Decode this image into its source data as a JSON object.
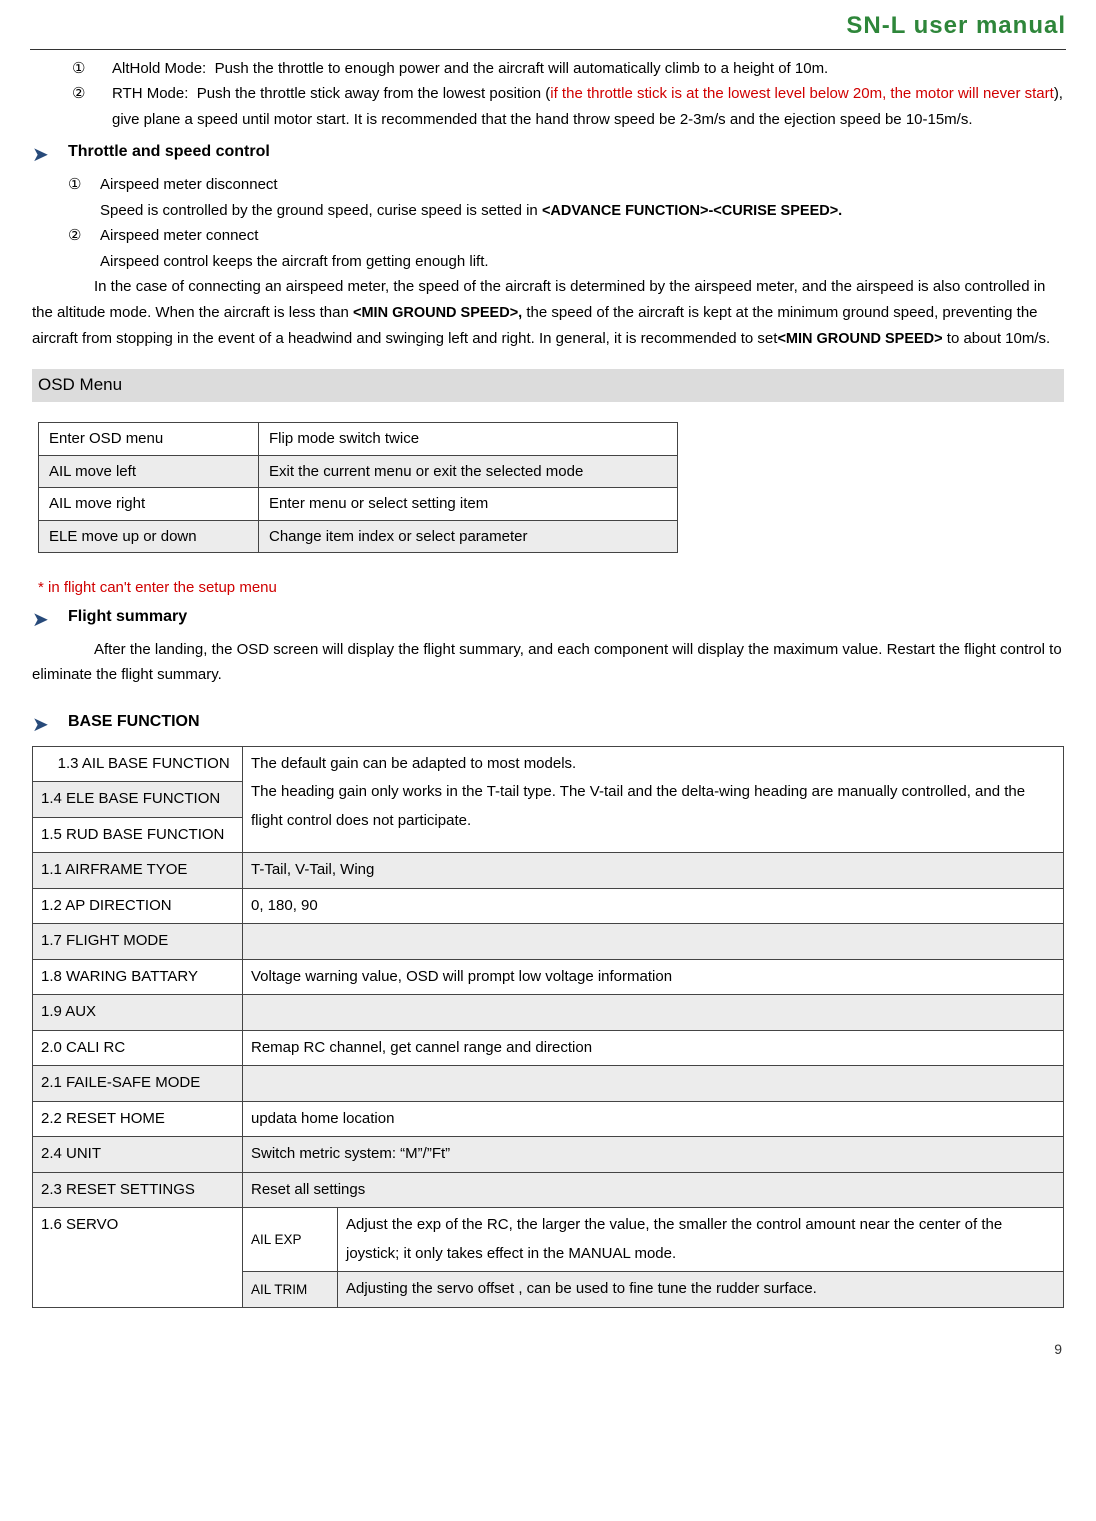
{
  "header": {
    "title": "SN-L user manual"
  },
  "intro": {
    "item1_num": "①",
    "item1_label": "AltHold Mode:",
    "item1_text": "Push the throttle to enough power and the aircraft will automatically climb to a height of 10m.",
    "item2_num": "②",
    "item2_label": "RTH Mode:",
    "item2_pre": "Push the throttle stick away from the lowest position (",
    "item2_red": "if the throttle stick is at the lowest level below 20m, the motor will never start",
    "item2_post": "), give plane a speed until motor start. It is recommended that the hand throw speed be 2-3m/s and the ejection speed be 10-15m/s."
  },
  "throttle": {
    "heading": "Throttle and speed control",
    "i1_num": "①",
    "i1_title": "Airspeed meter disconnect",
    "i1_text_a": "Speed is controlled by the ground speed, curise speed is setted in ",
    "i1_text_b": "<ADVANCE FUNCTION>-<CURISE SPEED>.",
    "i2_num": "②",
    "i2_title": "Airspeed meter connect",
    "i2_l1": "Airspeed control keeps the aircraft from getting enough lift.",
    "i2_l2a": "In the case of connecting an airspeed meter, the speed of the aircraft is determined by the airspeed meter, and the airspeed is also controlled in the altitude mode. When the aircraft is less than ",
    "i2_l2b": "<MIN GROUND SPEED>,",
    "i2_l2c": " the speed of the aircraft is kept at the minimum ground speed, preventing the aircraft from stopping in the event of a headwind and swinging left and right. In general, it is recommended to set",
    "i2_l2d": "<MIN GROUND SPEED>",
    "i2_l2e": " to about 10m/s."
  },
  "osd": {
    "heading": "OSD Menu",
    "rows": [
      {
        "c1": "Enter OSD menu",
        "c2": "Flip mode switch twice",
        "shaded": false
      },
      {
        "c1": "AIL move left",
        "c2": "Exit the current menu or exit the selected mode",
        "shaded": true
      },
      {
        "c1": "AIL move right",
        "c2": "Enter menu or select setting item",
        "shaded": false
      },
      {
        "c1": "ELE move up or down",
        "c2": "Change item index or select parameter",
        "shaded": true
      }
    ],
    "note": "* in flight can't enter the setup menu"
  },
  "flight_summary": {
    "heading": "Flight summary",
    "text": "After the landing, the OSD screen will display the flight summary, and each component will display the maximum value. Restart the flight control to eliminate the flight summary."
  },
  "base": {
    "heading": "BASE FUNCTION",
    "r1c1": "1.3 AIL BASE FUNCTION",
    "merged_desc": "The default gain can be adapted to most models.\nThe heading gain only works in the T-tail type. The V-tail and the delta-wing heading are manually controlled, and the flight control does not participate.",
    "r2c1": "1.4 ELE BASE FUNCTION",
    "r3c1": "1.5 RUD BASE FUNCTION",
    "r4c1": "1.1 AIRFRAME TYOE",
    "r4c2": "T-Tail,   V-Tail,   Wing",
    "r5c1": "1.2 AP DIRECTION",
    "r5c2": "0, 180, 90",
    "r6c1": "1.7 FLIGHT MODE",
    "r6c2": "",
    "r7c1": "1.8 WARING BATTARY",
    "r7c2": "Voltage warning value, OSD will prompt low voltage information",
    "r8c1": "1.9 AUX",
    "r8c2": "",
    "r9c1": "2.0 CALI RC",
    "r9c2": "Remap RC channel, get cannel range and direction",
    "r10c1": "2.1 FAILE-SAFE MODE",
    "r10c2": "",
    "r11c1": "2.2 RESET HOME",
    "r11c2": "updata home location",
    "r12c1": "2.4 UNIT",
    "r12c2": "Switch metric system: “M”/”Ft”",
    "r13c1": "2.3 RESET SETTINGS",
    "r13c2": "Reset all settings",
    "r14c1": "1.6 SERVO",
    "r14aA": "AIL EXP",
    "r14aB": "Adjust the exp of the RC, the larger the value, the smaller the control amount near the center of the joystick; it only takes effect in the MANUAL mode.",
    "r14bA": "AIL TRIM",
    "r14bB": "Adjusting the servo offset , can be used to fine tune the rudder surface."
  },
  "footer": {
    "page": "9"
  }
}
